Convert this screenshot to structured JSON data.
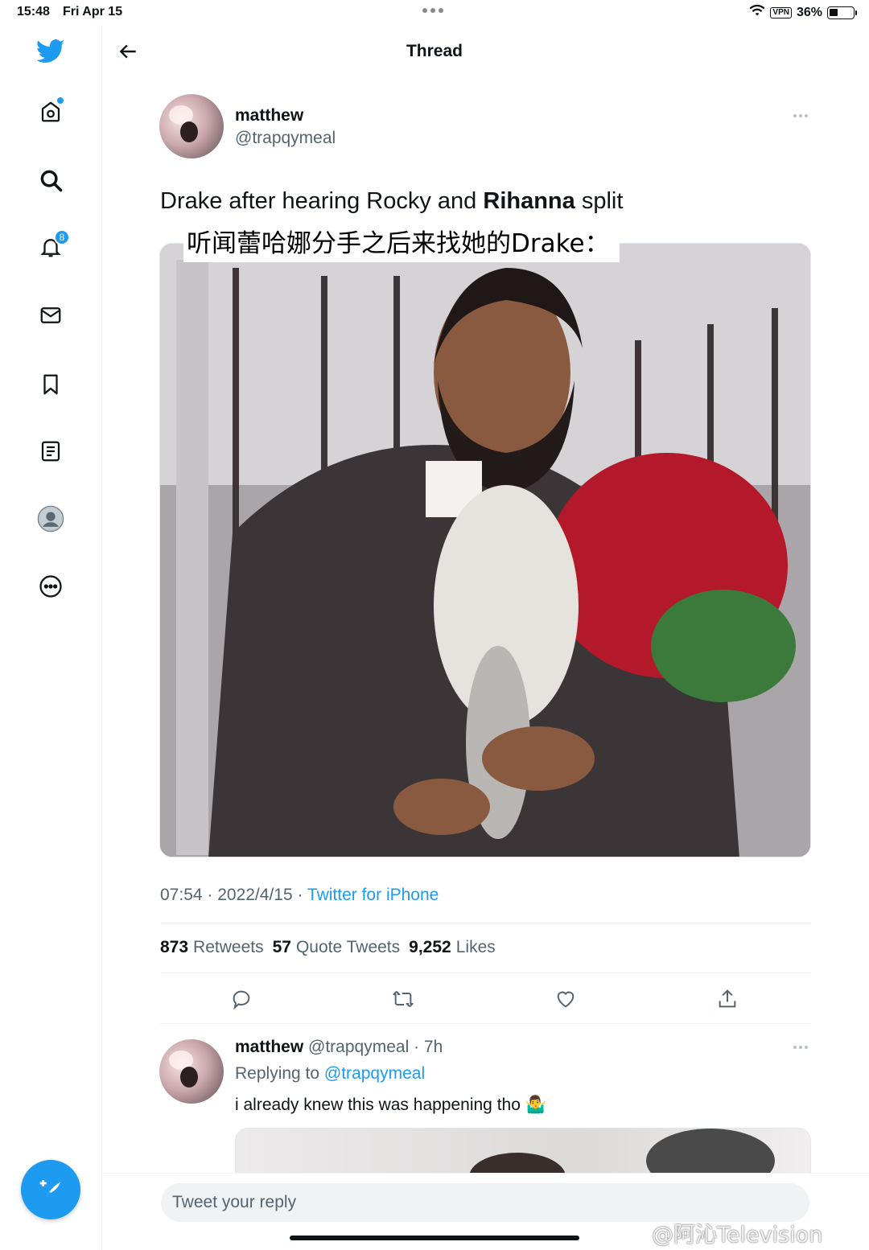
{
  "status_bar": {
    "time": "15:48",
    "date": "Fri Apr 15",
    "vpn": "VPN",
    "battery": "36%",
    "battery_level": 0.36
  },
  "sidebar": {
    "notifications_badge": "8"
  },
  "header": {
    "title": "Thread"
  },
  "tweet": {
    "author_name": "matthew",
    "author_handle": "@trapqymeal",
    "text_part1": "Drake after hearing Rocky and ",
    "text_bold": "Rihanna",
    "text_part2": " split",
    "image_caption": "听闻蕾哈娜分手之后来找她的Drake：",
    "time": "07:54 · 2022/4/15 · ",
    "source": "Twitter for iPhone",
    "retweets_count": "873",
    "retweets_label": "Retweets",
    "quotes_count": "57",
    "quotes_label": "Quote Tweets",
    "likes_count": "9,252",
    "likes_label": "Likes"
  },
  "reply": {
    "author_name": "matthew",
    "author_meta": "@trapqymeal · 7h",
    "replying_prefix": "Replying to ",
    "replying_handle": "@trapqymeal",
    "text": "i already knew this was happening tho 🤷‍♂️"
  },
  "composer": {
    "placeholder": "Tweet your reply"
  },
  "watermark": "@阿沁Television",
  "colors": {
    "accent": "#1d9bf0",
    "text": "#0f1419",
    "secondary": "#536471"
  }
}
